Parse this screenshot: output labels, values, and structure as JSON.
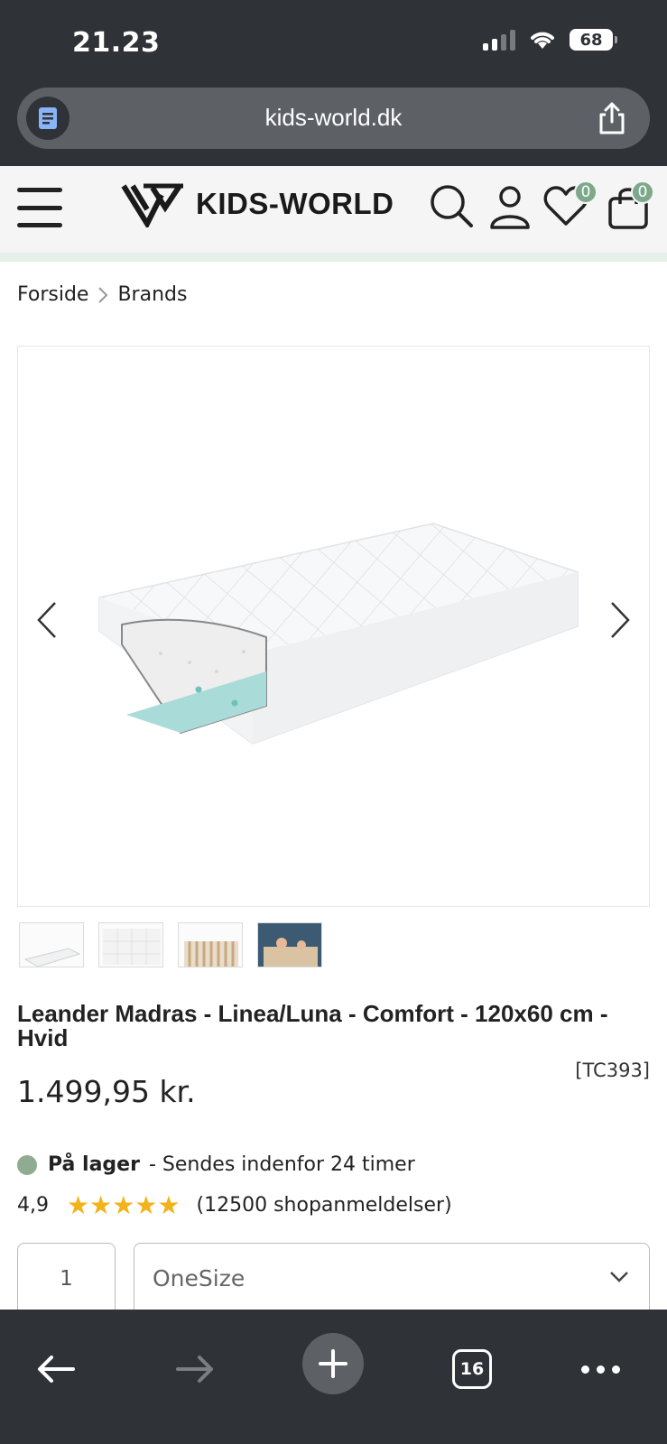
{
  "status_bar": {
    "time": "21.23",
    "battery": "68"
  },
  "browser": {
    "url": "kids-world.dk",
    "tab_count": "16"
  },
  "header": {
    "brand": "KIDS-WORLD",
    "wishlist_count": "0",
    "cart_count": "0",
    "icons": [
      "menu-icon",
      "search-icon",
      "user-icon",
      "heart-icon",
      "bag-icon"
    ]
  },
  "breadcrumb": {
    "items": [
      "Forside",
      "Brands"
    ]
  },
  "product": {
    "title": "Leander Madras - Linea/Luna - Comfort - 120x60 cm - Hvid",
    "sku": "[TC393]",
    "price": "1.499,95 kr.",
    "stock_label": "På lager",
    "stock_note": "- Sendes indenfor 24 timer",
    "rating_score": "4,9",
    "stars": "★★★★★",
    "rating_count": "(12500 shopanmeldelser)",
    "quantity": "1",
    "size": "OneSize"
  },
  "colors": {
    "accent_green": "#7da98a",
    "star": "#f2b31a",
    "chrome": "#2f3236"
  }
}
